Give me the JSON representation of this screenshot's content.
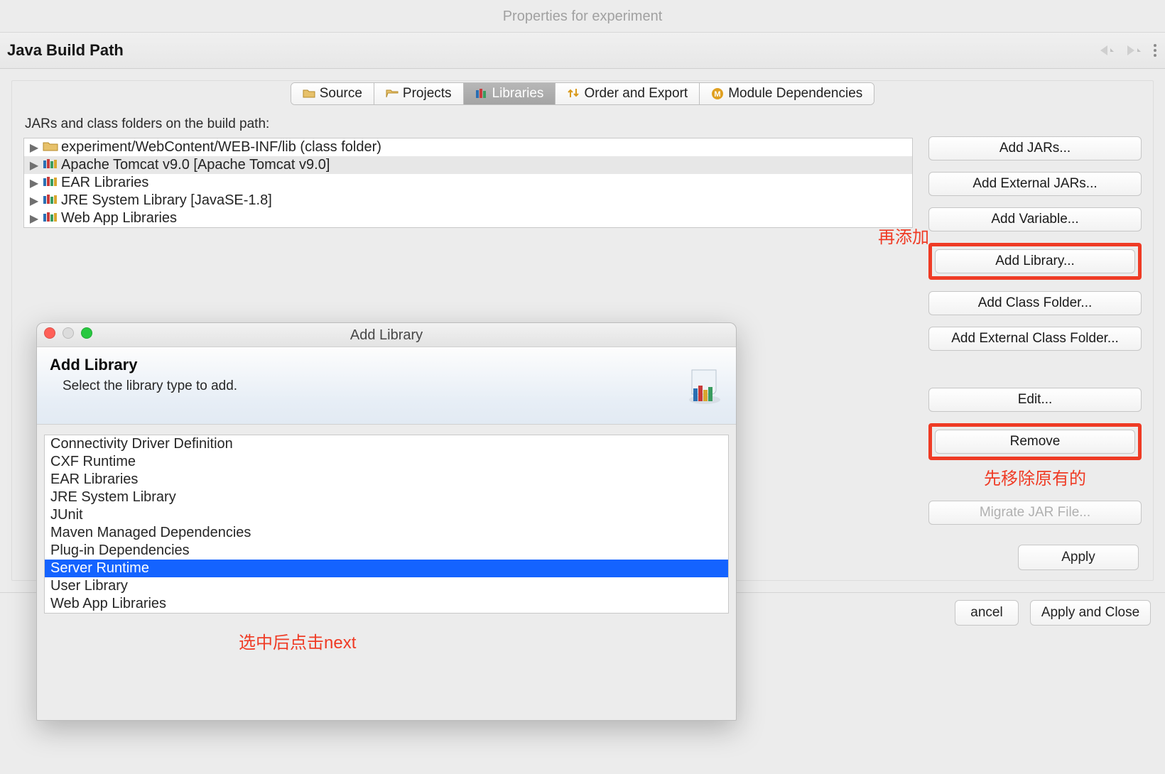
{
  "window": {
    "title": "Properties for experiment"
  },
  "page": {
    "title": "Java Build Path"
  },
  "tabs": {
    "source": "Source",
    "projects": "Projects",
    "libraries": "Libraries",
    "order": "Order and Export",
    "modules": "Module Dependencies"
  },
  "caption": "JARs and class folders on the build path:",
  "tree": [
    {
      "label": "experiment/WebContent/WEB-INF/lib (class folder)",
      "icon": "folder",
      "selected": false
    },
    {
      "label": "Apache Tomcat v9.0 [Apache Tomcat v9.0]",
      "icon": "lib",
      "selected": true
    },
    {
      "label": "EAR Libraries",
      "icon": "lib",
      "selected": false
    },
    {
      "label": "JRE System Library [JavaSE-1.8]",
      "icon": "lib",
      "selected": false
    },
    {
      "label": "Web App Libraries",
      "icon": "lib",
      "selected": false
    }
  ],
  "buttons": {
    "add_jars": "Add JARs...",
    "add_ext_jars": "Add External JARs...",
    "add_variable": "Add Variable...",
    "add_library": "Add Library...",
    "add_class_folder": "Add Class Folder...",
    "add_ext_class_folder": "Add External Class Folder...",
    "edit": "Edit...",
    "remove": "Remove",
    "migrate": "Migrate JAR File...",
    "apply": "Apply",
    "cancel": "ancel",
    "apply_close": "Apply and Close"
  },
  "annotations": {
    "add_again": "再添加",
    "remove_first": "先移除原有的",
    "select_next": "选中后点击next"
  },
  "modal": {
    "titlebar": "Add Library",
    "head_title": "Add Library",
    "head_sub": "Select the library type to add.",
    "items": [
      "Connectivity Driver Definition",
      "CXF Runtime",
      "EAR Libraries",
      "JRE System Library",
      "JUnit",
      "Maven Managed Dependencies",
      "Plug-in Dependencies",
      "Server Runtime",
      "User Library",
      "Web App Libraries"
    ],
    "selected_index": 7
  }
}
